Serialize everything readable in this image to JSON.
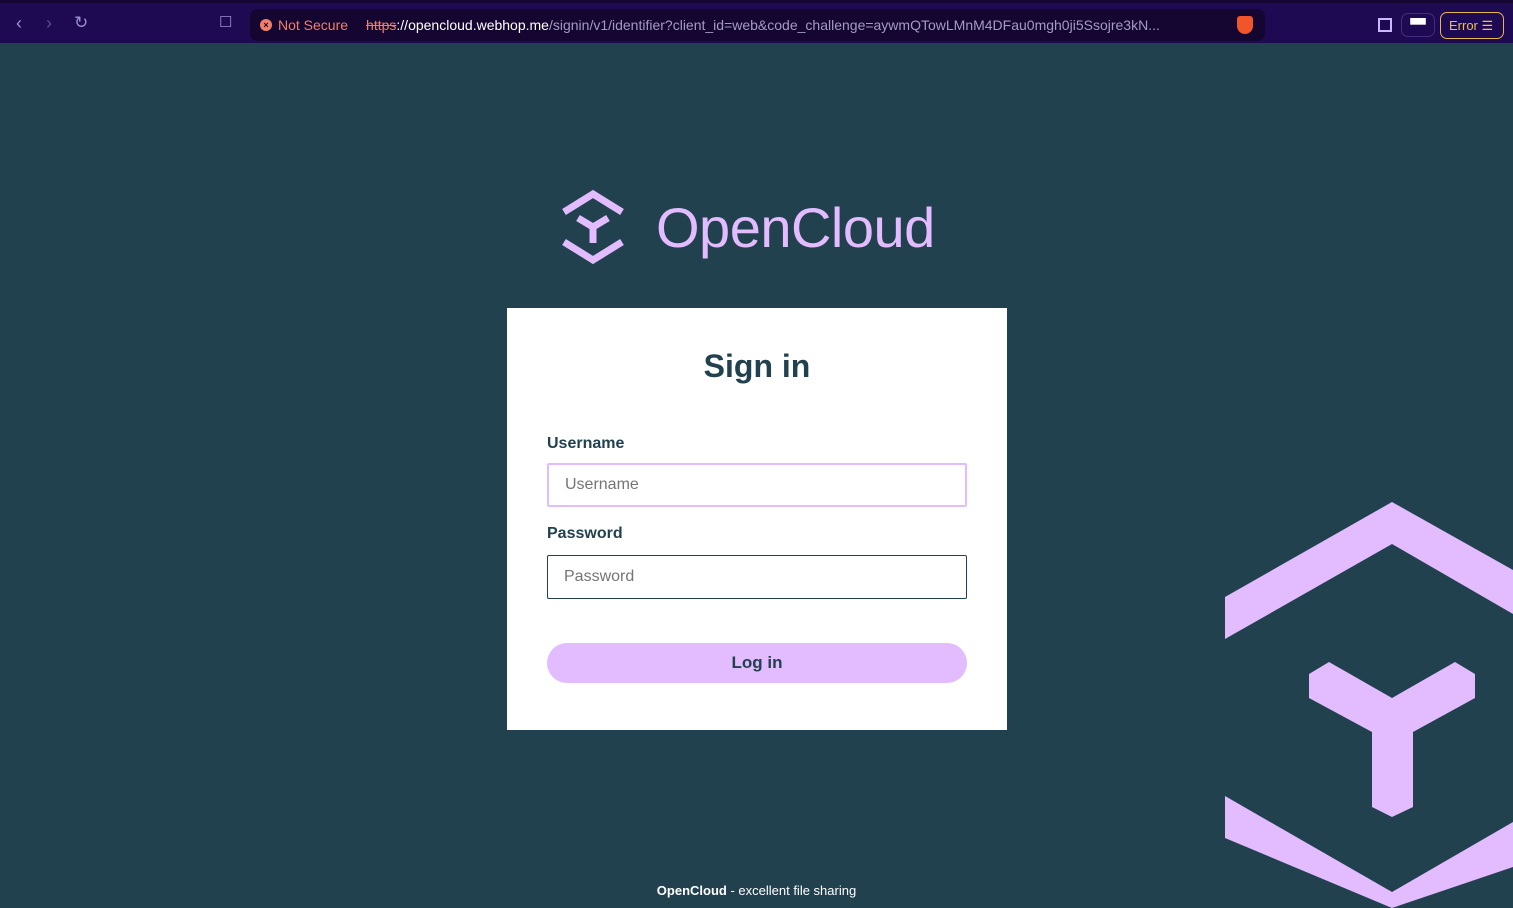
{
  "browser": {
    "not_secure": "Not Secure",
    "url_scheme": "https",
    "url_host": "://opencloud.webhop.me",
    "url_path": "/signin/v1/identifier?client_id=web&code_challenge=aywmQTowLMnM4DFau0mgh0ji5Ssojre3kN...",
    "error_label": "Error"
  },
  "logo": {
    "name": "OpenCloud"
  },
  "form": {
    "title": "Sign in",
    "username_label": "Username",
    "username_placeholder": "Username",
    "password_label": "Password",
    "password_placeholder": "Password",
    "login": "Log in"
  },
  "footer": {
    "brand": "OpenCloud",
    "tagline": " - excellent file sharing"
  }
}
